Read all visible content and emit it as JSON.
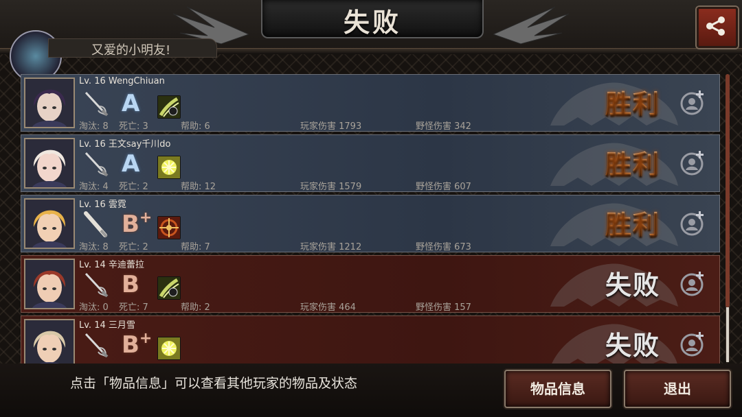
{
  "header": {
    "title": "失败",
    "behind_label": "又爱的小明友!"
  },
  "players": [
    {
      "level_name": "Lv. 16 WengChiuan",
      "grade": "A",
      "grade_plus": "",
      "kills": "淘汰: 8",
      "deaths": "死亡: 3",
      "assists": "帮助: 6",
      "player_damage": "玩家伤害 1793",
      "monster_damage": "野怪伤害 342",
      "result": "胜利",
      "team": "win",
      "weapon_icon": "rapier-icon",
      "skill_icon": "slash-skill-icon",
      "skill_color": "#c9d66a",
      "avatar_hair": "#3b2a4e",
      "avatar_skin": "#e7d2c6"
    },
    {
      "level_name": "Lv. 16 王文say千川do",
      "grade": "A",
      "grade_plus": "",
      "kills": "淘汰: 4",
      "deaths": "死亡: 2",
      "assists": "帮助: 12",
      "player_damage": "玩家伤害 1579",
      "monster_damage": "野怪伤害 607",
      "result": "胜利",
      "team": "win",
      "weapon_icon": "rapier-icon",
      "skill_icon": "burst-skill-icon",
      "skill_color": "#f0f260",
      "avatar_hair": "#f0e8e0",
      "avatar_skin": "#f2d6cc"
    },
    {
      "level_name": "Lv. 16 雲霓",
      "grade": "B",
      "grade_plus": "+",
      "kills": "淘汰: 8",
      "deaths": "死亡: 2",
      "assists": "帮助: 7",
      "player_damage": "玩家伤害 1212",
      "monster_damage": "野怪伤害 673",
      "result": "胜利",
      "team": "win",
      "weapon_icon": "bat-icon",
      "skill_icon": "target-skill-icon",
      "skill_color": "#c8541e",
      "avatar_hair": "#e8b24a",
      "avatar_skin": "#f1d0b4"
    },
    {
      "level_name": "Lv. 14 辛迪蕾拉",
      "grade": "B",
      "grade_plus": "",
      "kills": "淘汰: 0",
      "deaths": "死亡: 7",
      "assists": "帮助: 2",
      "player_damage": "玩家伤害 464",
      "monster_damage": "野怪伤害 157",
      "result": "失败",
      "team": "lose",
      "weapon_icon": "rapier-icon",
      "skill_icon": "slash-skill-icon",
      "skill_color": "#c9d66a",
      "avatar_hair": "#9a3a2a",
      "avatar_skin": "#efcdb4"
    },
    {
      "level_name": "Lv. 14 三月雪",
      "grade": "B",
      "grade_plus": "+",
      "kills": "",
      "deaths": "",
      "assists": "",
      "player_damage": "",
      "monster_damage": "",
      "result": "失败",
      "team": "lose",
      "weapon_icon": "rapier-icon",
      "skill_icon": "burst-skill-icon",
      "skill_color": "#f0f260",
      "avatar_hair": "#d8c8a8",
      "avatar_skin": "#efcfb6"
    }
  ],
  "footer": {
    "hint": "点击「物品信息」可以查看其他玩家的物品及状态",
    "items_button": "物品信息",
    "exit_button": "退出"
  },
  "colors": {
    "win_row": "#2c3646",
    "lose_row": "#3e1611",
    "button_red": "#5a2b22"
  }
}
